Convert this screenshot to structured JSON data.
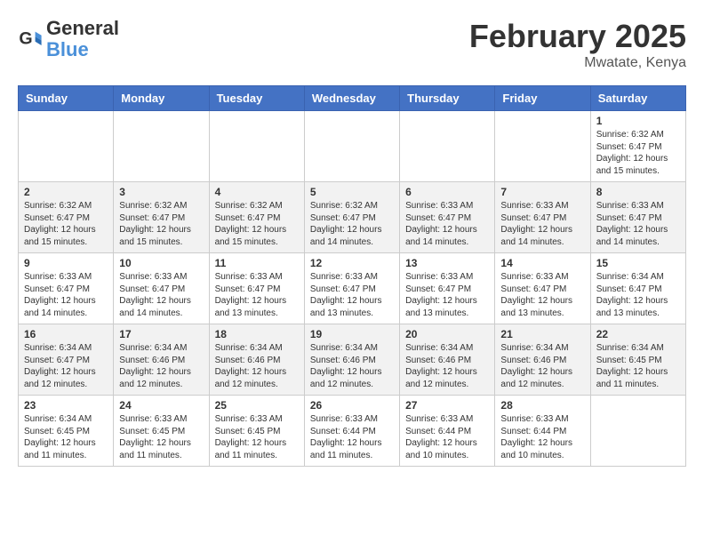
{
  "header": {
    "logo_general": "General",
    "logo_blue": "Blue",
    "month_year": "February 2025",
    "location": "Mwatate, Kenya"
  },
  "weekdays": [
    "Sunday",
    "Monday",
    "Tuesday",
    "Wednesday",
    "Thursday",
    "Friday",
    "Saturday"
  ],
  "weeks": [
    [
      {
        "day": "",
        "info": ""
      },
      {
        "day": "",
        "info": ""
      },
      {
        "day": "",
        "info": ""
      },
      {
        "day": "",
        "info": ""
      },
      {
        "day": "",
        "info": ""
      },
      {
        "day": "",
        "info": ""
      },
      {
        "day": "1",
        "info": "Sunrise: 6:32 AM\nSunset: 6:47 PM\nDaylight: 12 hours\nand 15 minutes."
      }
    ],
    [
      {
        "day": "2",
        "info": "Sunrise: 6:32 AM\nSunset: 6:47 PM\nDaylight: 12 hours\nand 15 minutes."
      },
      {
        "day": "3",
        "info": "Sunrise: 6:32 AM\nSunset: 6:47 PM\nDaylight: 12 hours\nand 15 minutes."
      },
      {
        "day": "4",
        "info": "Sunrise: 6:32 AM\nSunset: 6:47 PM\nDaylight: 12 hours\nand 15 minutes."
      },
      {
        "day": "5",
        "info": "Sunrise: 6:32 AM\nSunset: 6:47 PM\nDaylight: 12 hours\nand 14 minutes."
      },
      {
        "day": "6",
        "info": "Sunrise: 6:33 AM\nSunset: 6:47 PM\nDaylight: 12 hours\nand 14 minutes."
      },
      {
        "day": "7",
        "info": "Sunrise: 6:33 AM\nSunset: 6:47 PM\nDaylight: 12 hours\nand 14 minutes."
      },
      {
        "day": "8",
        "info": "Sunrise: 6:33 AM\nSunset: 6:47 PM\nDaylight: 12 hours\nand 14 minutes."
      }
    ],
    [
      {
        "day": "9",
        "info": "Sunrise: 6:33 AM\nSunset: 6:47 PM\nDaylight: 12 hours\nand 14 minutes."
      },
      {
        "day": "10",
        "info": "Sunrise: 6:33 AM\nSunset: 6:47 PM\nDaylight: 12 hours\nand 14 minutes."
      },
      {
        "day": "11",
        "info": "Sunrise: 6:33 AM\nSunset: 6:47 PM\nDaylight: 12 hours\nand 13 minutes."
      },
      {
        "day": "12",
        "info": "Sunrise: 6:33 AM\nSunset: 6:47 PM\nDaylight: 12 hours\nand 13 minutes."
      },
      {
        "day": "13",
        "info": "Sunrise: 6:33 AM\nSunset: 6:47 PM\nDaylight: 12 hours\nand 13 minutes."
      },
      {
        "day": "14",
        "info": "Sunrise: 6:33 AM\nSunset: 6:47 PM\nDaylight: 12 hours\nand 13 minutes."
      },
      {
        "day": "15",
        "info": "Sunrise: 6:34 AM\nSunset: 6:47 PM\nDaylight: 12 hours\nand 13 minutes."
      }
    ],
    [
      {
        "day": "16",
        "info": "Sunrise: 6:34 AM\nSunset: 6:47 PM\nDaylight: 12 hours\nand 12 minutes."
      },
      {
        "day": "17",
        "info": "Sunrise: 6:34 AM\nSunset: 6:46 PM\nDaylight: 12 hours\nand 12 minutes."
      },
      {
        "day": "18",
        "info": "Sunrise: 6:34 AM\nSunset: 6:46 PM\nDaylight: 12 hours\nand 12 minutes."
      },
      {
        "day": "19",
        "info": "Sunrise: 6:34 AM\nSunset: 6:46 PM\nDaylight: 12 hours\nand 12 minutes."
      },
      {
        "day": "20",
        "info": "Sunrise: 6:34 AM\nSunset: 6:46 PM\nDaylight: 12 hours\nand 12 minutes."
      },
      {
        "day": "21",
        "info": "Sunrise: 6:34 AM\nSunset: 6:46 PM\nDaylight: 12 hours\nand 12 minutes."
      },
      {
        "day": "22",
        "info": "Sunrise: 6:34 AM\nSunset: 6:45 PM\nDaylight: 12 hours\nand 11 minutes."
      }
    ],
    [
      {
        "day": "23",
        "info": "Sunrise: 6:34 AM\nSunset: 6:45 PM\nDaylight: 12 hours\nand 11 minutes."
      },
      {
        "day": "24",
        "info": "Sunrise: 6:33 AM\nSunset: 6:45 PM\nDaylight: 12 hours\nand 11 minutes."
      },
      {
        "day": "25",
        "info": "Sunrise: 6:33 AM\nSunset: 6:45 PM\nDaylight: 12 hours\nand 11 minutes."
      },
      {
        "day": "26",
        "info": "Sunrise: 6:33 AM\nSunset: 6:44 PM\nDaylight: 12 hours\nand 11 minutes."
      },
      {
        "day": "27",
        "info": "Sunrise: 6:33 AM\nSunset: 6:44 PM\nDaylight: 12 hours\nand 10 minutes."
      },
      {
        "day": "28",
        "info": "Sunrise: 6:33 AM\nSunset: 6:44 PM\nDaylight: 12 hours\nand 10 minutes."
      },
      {
        "day": "",
        "info": ""
      }
    ]
  ]
}
